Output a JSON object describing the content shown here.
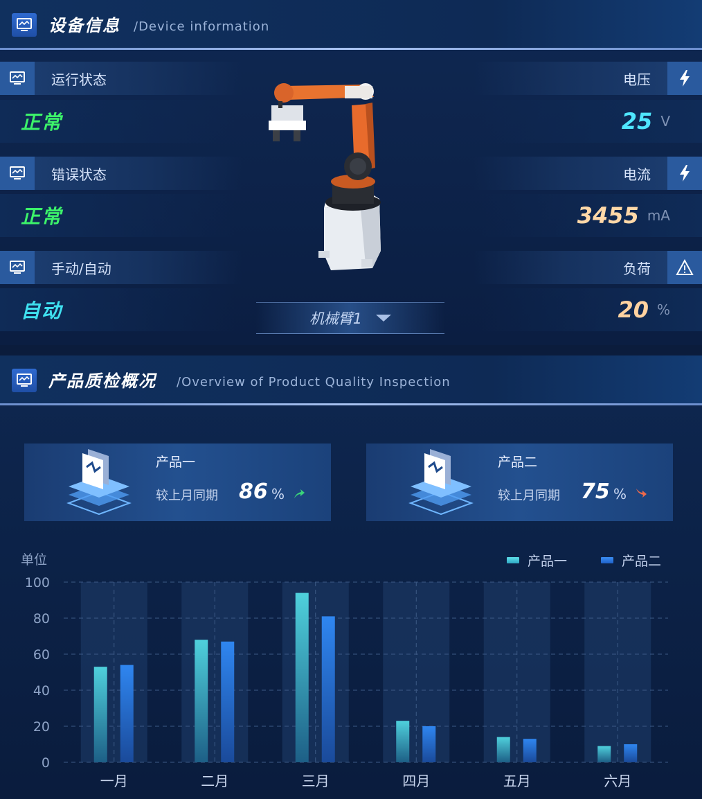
{
  "device": {
    "title": "设备信息",
    "subtitle": "/Device information",
    "left_rows": [
      {
        "label": "运行状态",
        "value": "正常",
        "color": "#3cf26a"
      },
      {
        "label": "错误状态",
        "value": "正常",
        "color": "#3cf26a"
      },
      {
        "label": "手动/自动",
        "value": "自动",
        "color": "#3fe0f0"
      }
    ],
    "right_rows": [
      {
        "label": "电压",
        "value": "25",
        "unit": "V",
        "color": "#4fe6ff",
        "icon": "lightning-icon"
      },
      {
        "label": "电流",
        "value": "3455",
        "unit": "mA",
        "color": "#ffd8a8",
        "icon": "lightning-icon"
      },
      {
        "label": "负荷",
        "value": "20",
        "unit": "%",
        "color": "#ffd2a0",
        "icon": "warning-icon"
      }
    ],
    "selector_label": "机械臂1"
  },
  "quality": {
    "title": "产品质检概况",
    "subtitle": "/Overview of Product Quality Inspection",
    "cards": [
      {
        "name": "产品一",
        "compare_label": "较上月同期",
        "percent": "86",
        "unit": "%",
        "trend": "up"
      },
      {
        "name": "产品二",
        "compare_label": "较上月同期",
        "percent": "75",
        "unit": "%",
        "trend": "down"
      }
    ]
  },
  "chart_data": {
    "type": "bar",
    "ylabel": "单位",
    "ylim": [
      0,
      100
    ],
    "yticks": [
      0,
      20,
      40,
      60,
      80,
      100
    ],
    "categories": [
      "一月",
      "二月",
      "三月",
      "四月",
      "五月",
      "六月"
    ],
    "series": [
      {
        "name": "产品一",
        "values": [
          53,
          68,
          94,
          23,
          14,
          9
        ],
        "color": "#3fc6d6"
      },
      {
        "name": "产品二",
        "values": [
          54,
          67,
          81,
          20,
          13,
          10
        ],
        "color": "#2b7de9"
      }
    ],
    "grid": true,
    "legend": "top-right"
  }
}
